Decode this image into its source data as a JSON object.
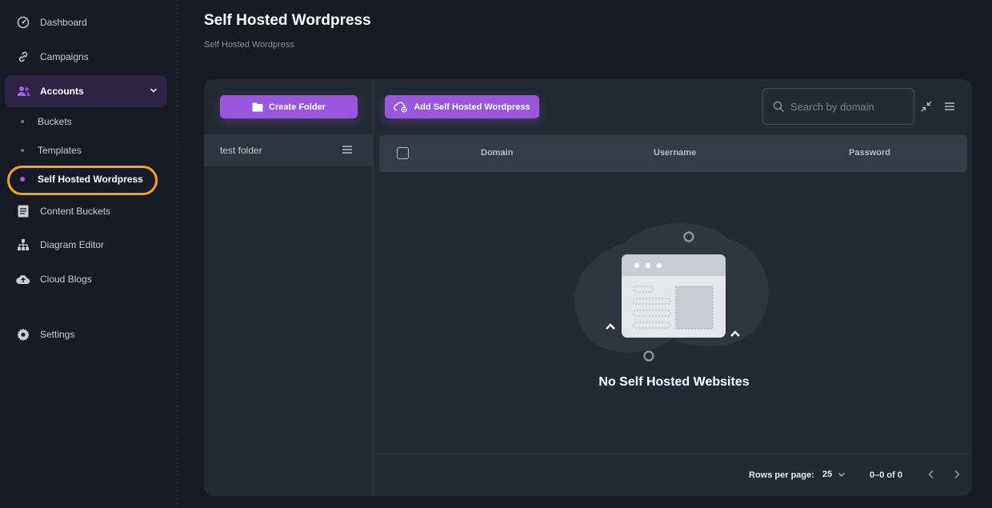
{
  "sidebar": {
    "items": [
      {
        "label": "Dashboard",
        "icon": "speedometer-icon"
      },
      {
        "label": "Campaigns",
        "icon": "link-icon"
      },
      {
        "label": "Accounts",
        "icon": "users-icon"
      },
      {
        "label": "Content Buckets",
        "icon": "document-icon"
      },
      {
        "label": "Diagram Editor",
        "icon": "sitemap-icon"
      },
      {
        "label": "Cloud Blogs",
        "icon": "cloud-upload-icon"
      },
      {
        "label": "Settings",
        "icon": "gear-icon"
      }
    ],
    "sub_items": [
      {
        "label": "Buckets"
      },
      {
        "label": "Templates"
      },
      {
        "label": "Self Hosted Wordpress"
      }
    ],
    "accent_color": "#a160e8",
    "highlight_color": "#f5a31a"
  },
  "header": {
    "title": "Self Hosted Wordpress",
    "breadcrumb": "Self Hosted Wordpress"
  },
  "folders": {
    "create_label": "Create Folder",
    "items": [
      {
        "name": "test folder"
      }
    ]
  },
  "toolbar": {
    "add_label": "Add Self Hosted Wordpress",
    "search_placeholder": "Search by domain"
  },
  "table": {
    "columns": [
      "Domain",
      "Username",
      "Password"
    ],
    "empty_message": "No Self Hosted Websites"
  },
  "pagination": {
    "rows_per_page_label": "Rows per page:",
    "rows_per_page_value": "25",
    "range": "0–0 of 0"
  }
}
